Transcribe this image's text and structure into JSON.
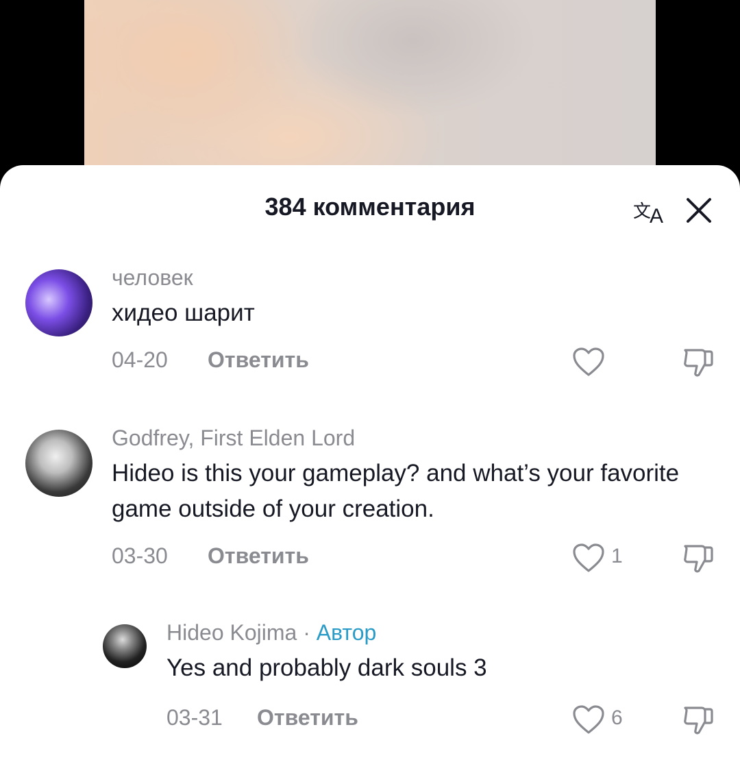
{
  "header": {
    "title": "384 комментария",
    "translate_icon": "translate-icon",
    "close_icon": "close-icon"
  },
  "comments": [
    {
      "username": "человек",
      "text": "хидео шарит",
      "date": "04-20",
      "reply_label": "Ответить",
      "likes": "",
      "avatar_colors": [
        "#6a3fd8",
        "#c9b8ff",
        "#2a1b5c"
      ]
    },
    {
      "username": "Godfrey, First Elden Lord",
      "text": "Hideo is this your gameplay? and what’s your favorite game outside of your creation.",
      "date": "03-30",
      "reply_label": "Ответить",
      "likes": "1",
      "avatar_colors": [
        "#2a2a2a",
        "#d9d9d9",
        "#111111"
      ]
    }
  ],
  "reply": {
    "username": "Hideo Kojima",
    "separator": " · ",
    "badge": "Автор",
    "text": "Yes and probably dark souls 3",
    "date": "03-31",
    "reply_label": "Ответить",
    "likes": "6",
    "avatar_colors": [
      "#1a1a1a",
      "#cfcfcf",
      "#000000"
    ]
  },
  "icons": {
    "like": "heart-icon",
    "dislike": "thumbs-down-icon"
  }
}
